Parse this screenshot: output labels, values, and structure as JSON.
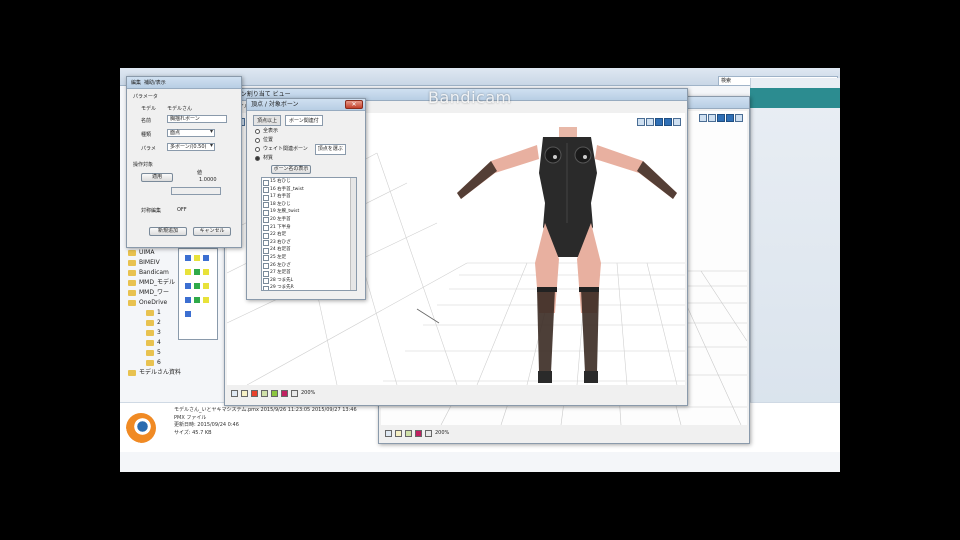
{
  "watermark": "Bandicam",
  "explorer": {
    "search_label": "検索",
    "tree": [
      "UIMA",
      "BIMEIV",
      "Bandicam",
      "MMD_モデル",
      "MMD_ワー",
      "OneDrive",
      "1",
      "2",
      "3",
      "4",
      "5",
      "6",
      "モデルさん資料"
    ],
    "file": {
      "name": "モデルさん_いとヤキマシステム.pmx  2015/9/26 11:23:05  2015/09/27 13:46",
      "type": "PMX ファイル",
      "modified": "更新日時: 2015/09/24 0:46",
      "size": "サイズ: 45.7 KB"
    }
  },
  "param_dialog": {
    "menu": [
      "編集",
      "補助/表示"
    ],
    "section": "パラメータ",
    "model_label": "モデル",
    "model_value": "モデルさん",
    "name_label": "名前",
    "name_value": "胸揺れボーン",
    "type_label": "種類",
    "type_value": "面点",
    "param_label": "パラメ",
    "param_value": "多ボーン/(0.50)",
    "operation_label": "操作対象",
    "apply_btn": "適用",
    "weight_label": "値",
    "weight_value": "1.0000",
    "sync_label": "対称編集",
    "sync_value": "OFF",
    "ok_btn": "新規追加",
    "cancel_btn": "キャンセル"
  },
  "bone_dialog": {
    "title": "頂点 / 対象ボーン",
    "tabs": [
      "頂点以上",
      "ボーン関連付"
    ],
    "options": [
      "全表示",
      "位置",
      "ウェイト関連ボーン",
      "材質"
    ],
    "option_extra": "頂点を選ぶ",
    "filter_btn": "ボーン名の表示",
    "rows": [
      "15 右ひじ",
      "16 右手首_twist",
      "17 右手首",
      "18 左ひじ",
      "19 左腕_twist",
      "20 左手首",
      "21 下半身",
      "22 右足",
      "23 右ひざ",
      "24 右足首",
      "25 左足",
      "26 左ひざ",
      "27 左足首",
      "28 つま先L",
      "29 つま先R",
      "30 胸揺れ",
      "31 胸揺れR",
      "Fukumi",
      "Tsuno",
      "Mune",
      "MuneR"
    ],
    "selected_index": 15
  },
  "viewer_main": {
    "title": "ボーン割り当て ビュー",
    "menu": [
      "ファイル",
      "表示",
      "位置",
      "ボーン",
      "材質"
    ],
    "status_text": "200%"
  },
  "viewer_back": {
    "title": "PmxView",
    "status_text": "200%"
  },
  "colors": {
    "selection": "#3399ff",
    "accent": "#2f6fb5",
    "teal": "#2c8c90"
  }
}
